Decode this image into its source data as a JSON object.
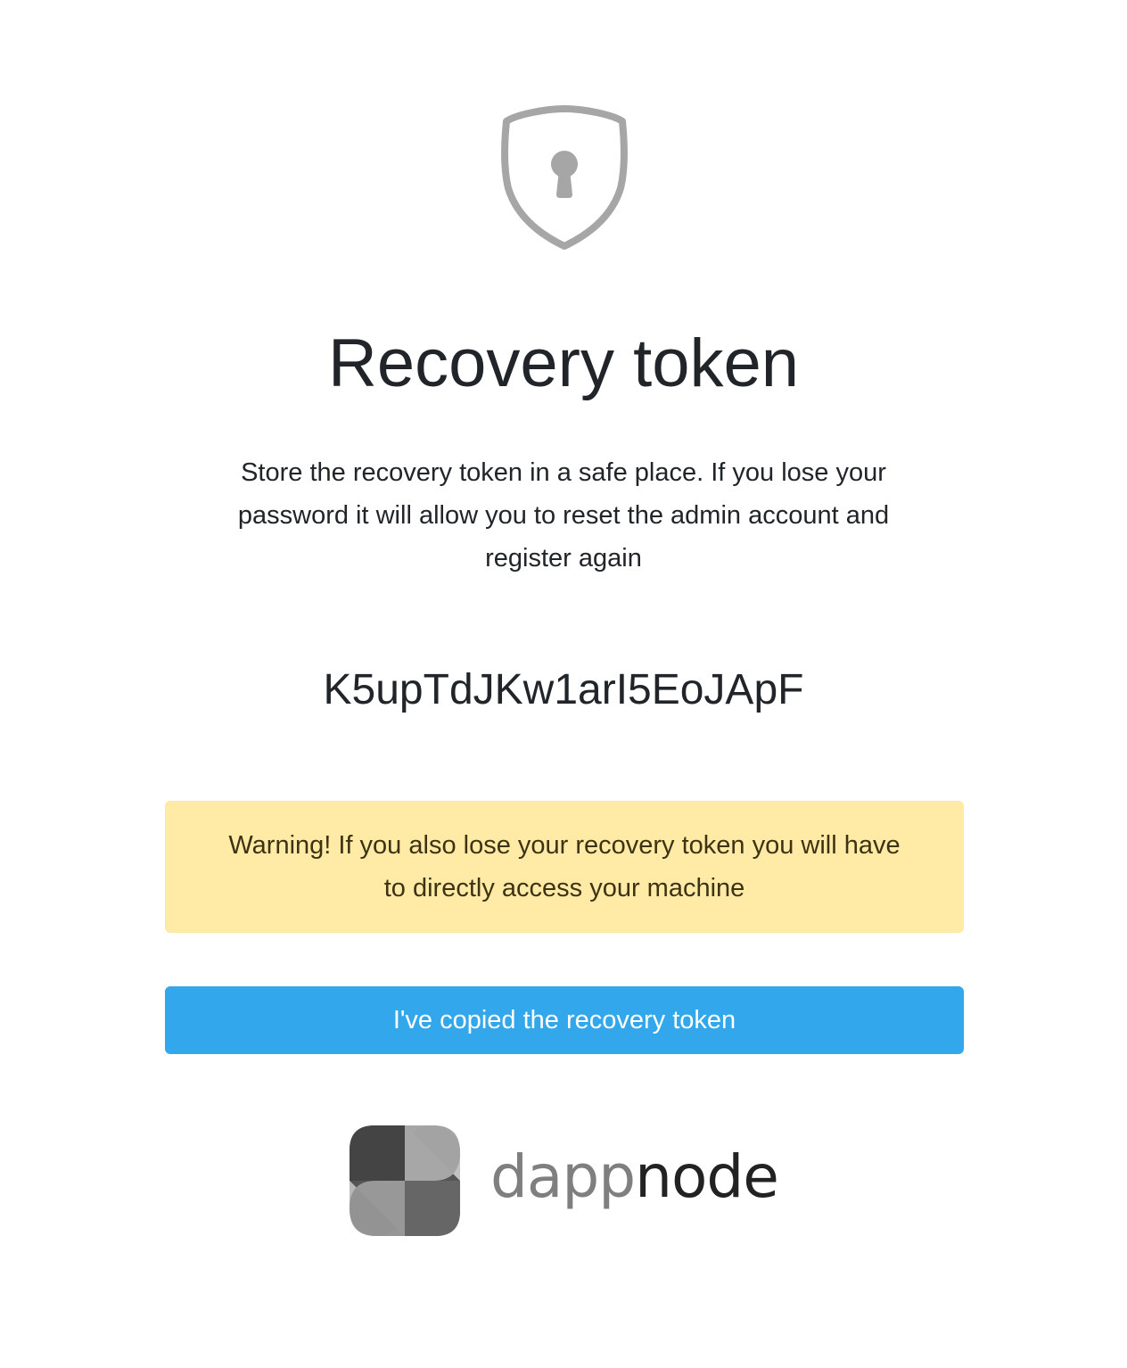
{
  "header": {
    "icon": "shield-keyhole-icon",
    "title": "Recovery token"
  },
  "main": {
    "description": "Store the recovery token in a safe place. If you lose your password it will allow you to reset the admin account and register again",
    "token": "K5upTdJKw1arI5EoJApF",
    "warning": "Warning! If you also lose your recovery token you will have to directly access your machine",
    "confirm_button": "I've copied the recovery token"
  },
  "footer": {
    "logo_text_light": "dapp",
    "logo_text_dark": "node",
    "logo_icon": "dappnode-logo-icon"
  },
  "colors": {
    "warning_bg": "#ffeba5",
    "button_bg": "#33a7eb",
    "icon_gray": "#a6a6a6"
  }
}
